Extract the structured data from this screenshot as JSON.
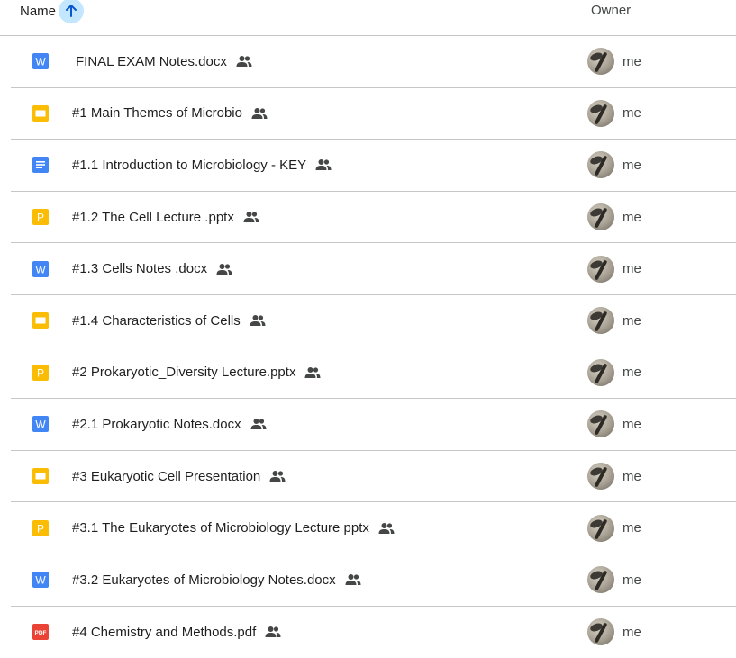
{
  "header": {
    "name_label": "Name",
    "owner_label": "Owner",
    "sort_direction": "ascending"
  },
  "colors": {
    "word": "#4285f4",
    "slides": "#fbbc04",
    "docs": "#4285f4",
    "powerpoint": "#fbbc04",
    "pdf": "#ea4335",
    "sort_highlight": "#c2e7ff"
  },
  "files": [
    {
      "name": "FINAL EXAM Notes.docx",
      "type": "word",
      "icon_letter": "W",
      "shared": true,
      "owner": "me"
    },
    {
      "name": "#1 Main Themes of Microbio",
      "type": "slides",
      "icon_letter": "",
      "shared": true,
      "owner": "me"
    },
    {
      "name": "#1.1 Introduction to Microbiology - KEY",
      "type": "docs",
      "icon_letter": "",
      "shared": true,
      "owner": "me"
    },
    {
      "name": "#1.2 The Cell Lecture .pptx",
      "type": "powerpoint",
      "icon_letter": "P",
      "shared": true,
      "owner": "me"
    },
    {
      "name": "#1.3 Cells Notes .docx",
      "type": "word",
      "icon_letter": "W",
      "shared": true,
      "owner": "me"
    },
    {
      "name": "#1.4 Characteristics of Cells",
      "type": "slides",
      "icon_letter": "",
      "shared": true,
      "owner": "me"
    },
    {
      "name": "#2 Prokaryotic_Diversity Lecture.pptx",
      "type": "powerpoint",
      "icon_letter": "P",
      "shared": true,
      "owner": "me"
    },
    {
      "name": "#2.1 Prokaryotic Notes.docx",
      "type": "word",
      "icon_letter": "W",
      "shared": true,
      "owner": "me"
    },
    {
      "name": "#3 Eukaryotic Cell Presentation",
      "type": "slides",
      "icon_letter": "",
      "shared": true,
      "owner": "me"
    },
    {
      "name": "#3.1 The Eukaryotes of Microbiology Lecture pptx",
      "type": "powerpoint",
      "icon_letter": "P",
      "shared": true,
      "owner": "me"
    },
    {
      "name": "#3.2 Eukaryotes of Microbiology Notes.docx",
      "type": "word",
      "icon_letter": "W",
      "shared": true,
      "owner": "me"
    },
    {
      "name": "#4 Chemistry and Methods.pdf",
      "type": "pdf",
      "icon_letter": "PDF",
      "shared": true,
      "owner": "me"
    }
  ]
}
